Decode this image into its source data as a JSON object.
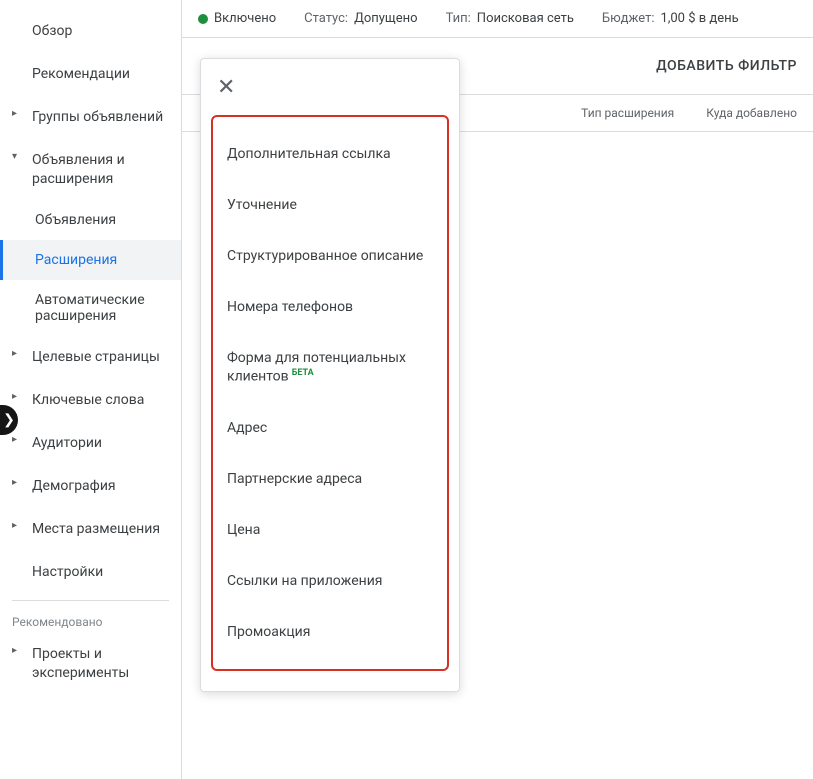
{
  "sidebar": {
    "items": [
      {
        "label": "Обзор",
        "hasArrow": false
      },
      {
        "label": "Рекомендации",
        "hasArrow": false
      },
      {
        "label": "Группы объявлений",
        "hasArrow": true,
        "arrow": "▸"
      },
      {
        "label": "Объявления и расширения",
        "hasArrow": true,
        "arrow": "▾",
        "expanded": true,
        "children": [
          {
            "label": "Объявления",
            "active": false
          },
          {
            "label": "Расширения",
            "active": true
          },
          {
            "label": "Автоматические расширения",
            "active": false
          }
        ]
      },
      {
        "label": "Целевые страницы",
        "hasArrow": true,
        "arrow": "▸"
      },
      {
        "label": "Ключевые слова",
        "hasArrow": true,
        "arrow": "▸"
      },
      {
        "label": "Аудитории",
        "hasArrow": true,
        "arrow": "▸"
      },
      {
        "label": "Демография",
        "hasArrow": true,
        "arrow": "▸"
      },
      {
        "label": "Места размещения",
        "hasArrow": true,
        "arrow": "▸"
      },
      {
        "label": "Настройки",
        "hasArrow": false
      }
    ],
    "recommendedLabel": "Рекомендовано",
    "recommendedItems": [
      {
        "label": "Проекты и эксперименты",
        "hasArrow": true,
        "arrow": "▸"
      }
    ]
  },
  "statusBar": {
    "enabled": "Включено",
    "statusLabel": "Статус:",
    "statusValue": "Допущено",
    "typeLabel": "Тип:",
    "typeValue": "Поисковая сеть",
    "budgetLabel": "Бюджет:",
    "budgetValue": "1,00 $ в день"
  },
  "filterRow": {
    "addFilter": "ДОБАВИТЬ ФИЛЬТР"
  },
  "columns": {
    "extType": "Тип расширения",
    "addedTo": "Куда добавлено"
  },
  "popup": {
    "items": [
      {
        "label": "Дополнительная ссылка"
      },
      {
        "label": "Уточнение"
      },
      {
        "label": "Структурированное описание"
      },
      {
        "label": "Номера телефонов"
      },
      {
        "label": "Форма для потенциальных клиентов",
        "badge": "БЕТА"
      },
      {
        "label": "Адрес"
      },
      {
        "label": "Партнерские адреса"
      },
      {
        "label": "Цена"
      },
      {
        "label": "Ссылки на приложения"
      },
      {
        "label": "Промоакция"
      }
    ]
  }
}
